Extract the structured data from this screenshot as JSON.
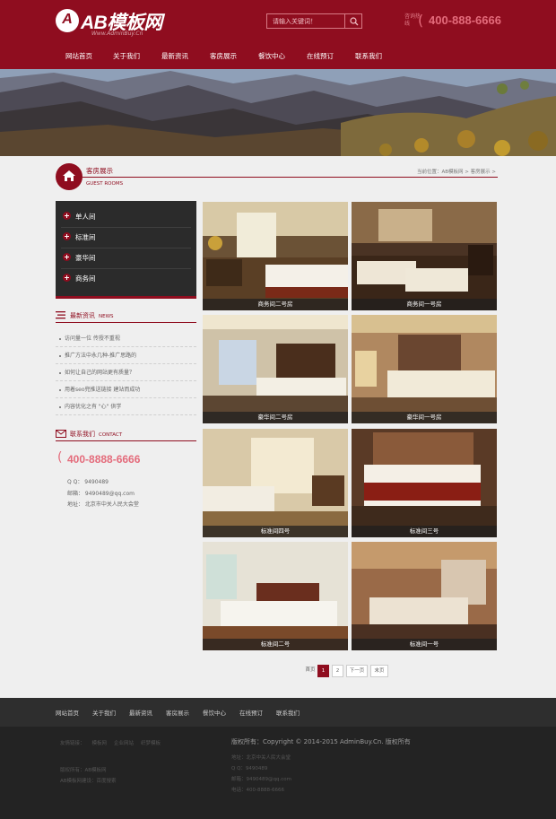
{
  "header": {
    "logo_text": "AB模板网",
    "logo_letter": "A",
    "logo_sub": "Www.AdminBuy.Cn",
    "search_placeholder": "请输入关键词！",
    "hotline_label": "咨询热线",
    "hotline_number": "400-888-6666"
  },
  "nav": [
    "网站首页",
    "关于我们",
    "最新资讯",
    "客房展示",
    "餐饮中心",
    "在线预订",
    "联系我们"
  ],
  "section": {
    "title": "客房展示",
    "title_en": "GUEST ROOMS",
    "breadcrumb": "当前位置：AB模板网 > 客房展示 >"
  },
  "sidebar": {
    "menu": [
      "单人间",
      "标准间",
      "豪华间",
      "商务间"
    ],
    "news_title": "最新资讯",
    "news_title_en": "NEWS",
    "news": [
      "访问量一位 传授不重视",
      "推广方法中永几种-推广思路的",
      "如何让自己的网站更有质量？",
      "用着seo兜推送链接 建站而成功",
      "内容优化之有 \"心\" 供学"
    ],
    "contact_title": "联系我们",
    "contact_title_en": "CONTACT",
    "contact_phone": "400-8888-6666",
    "contact_qq": "Q Q： 9490489",
    "contact_email": "邮箱： 9490489@qq.com",
    "contact_address": "地址： 北京市中关人民大会堂"
  },
  "rooms": [
    {
      "caption": "商务间二号房"
    },
    {
      "caption": "商务间一号房"
    },
    {
      "caption": "豪华间二号房"
    },
    {
      "caption": "豪华间一号房"
    },
    {
      "caption": "标准间四号"
    },
    {
      "caption": "标准间三号"
    },
    {
      "caption": "标准间二号"
    },
    {
      "caption": "标准间一号"
    }
  ],
  "pager": {
    "label": "首页",
    "current": "1",
    "next_num": "2",
    "next": "下一页",
    "last": "末页"
  },
  "footer_nav": [
    "网站首页",
    "关于我们",
    "最新资讯",
    "客房展示",
    "餐饮中心",
    "在线预订",
    "联系我们"
  ],
  "footer": {
    "links_label": "友情链接：",
    "links": [
      "模板网",
      "企业网站",
      "织梦模板"
    ],
    "left_line1": "版权所有：AB模板网",
    "left_line2": "AB模板网建设：百度搜索",
    "copyright": "版权所有：Copyright © 2014-2015 AdminBuy.Cn. 版权所有",
    "addr": "地址：北京中关人民大会堂",
    "qq": "Q Q：9490489",
    "email": "邮箱：9490489@qq.com",
    "tel": "电话：400-8888-6666"
  },
  "colors": {
    "brand": "#8f0d1f",
    "accent": "#e46b7b",
    "footer": "#232323"
  }
}
